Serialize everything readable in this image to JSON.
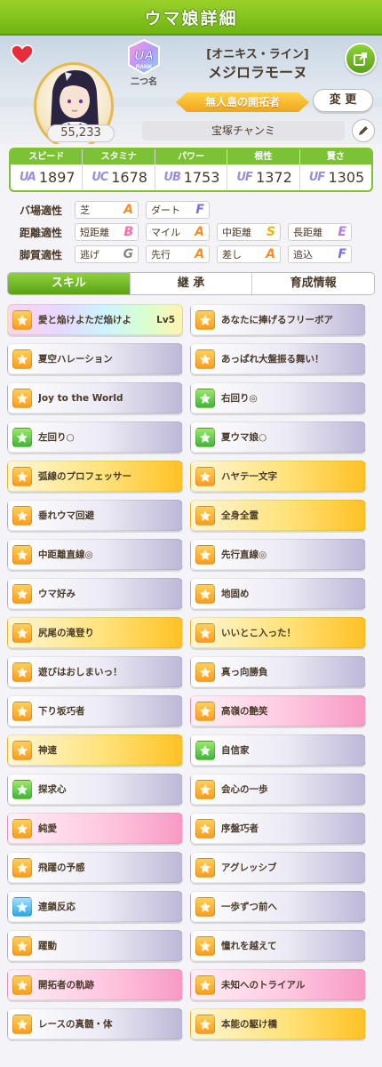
{
  "header": {
    "title": "ウマ娘詳細"
  },
  "profile": {
    "fans": "55,233",
    "rank_label": "UA",
    "rank_word": "RANK",
    "rank_sub": "二つ名",
    "epithet": "[オニキス・ライン]",
    "name": "メジロラモーヌ",
    "title_ribbon": "無人島の開拓者",
    "change_label": "変 更",
    "trainer": "宝塚チャンミ"
  },
  "stats": [
    {
      "label": "スピード",
      "grade": "UA",
      "value": "1897"
    },
    {
      "label": "スタミナ",
      "grade": "UC",
      "value": "1678"
    },
    {
      "label": "パワー",
      "grade": "UB",
      "value": "1753"
    },
    {
      "label": "根性",
      "grade": "UF",
      "value": "1372"
    },
    {
      "label": "賢さ",
      "grade": "UF",
      "value": "1305"
    }
  ],
  "aptitudes": [
    {
      "label": "バ場適性",
      "cells": [
        {
          "name": "芝",
          "grade": "A"
        },
        {
          "name": "ダート",
          "grade": "F"
        }
      ]
    },
    {
      "label": "距離適性",
      "cells": [
        {
          "name": "短距離",
          "grade": "B"
        },
        {
          "name": "マイル",
          "grade": "A"
        },
        {
          "name": "中距離",
          "grade": "S"
        },
        {
          "name": "長距離",
          "grade": "E"
        }
      ]
    },
    {
      "label": "脚質適性",
      "cells": [
        {
          "name": "逃げ",
          "grade": "G"
        },
        {
          "name": "先行",
          "grade": "A"
        },
        {
          "name": "差し",
          "grade": "A"
        },
        {
          "name": "追込",
          "grade": "F"
        }
      ]
    }
  ],
  "grade_colors": {
    "S": "#f0b300",
    "A": "#ff8a1e",
    "B": "#ff6aa8",
    "C": "#7bc83a",
    "D": "#3fb2e0",
    "E": "#b87ae0",
    "F": "#7a6ee6",
    "G": "#8a8a8a"
  },
  "tabs": [
    "スキル",
    "継 承",
    "育成情報"
  ],
  "skills": [
    {
      "name": "愛と焔けよただ焔けよ",
      "lv": "Lv5",
      "style": "rainbow",
      "icon": "orange"
    },
    {
      "name": "あなたに捧げるフリーボア",
      "style": "normal",
      "icon": "orange"
    },
    {
      "name": "夏空ハレーション",
      "style": "normal",
      "icon": "orange"
    },
    {
      "name": "あっぱれ大盤振る舞い！",
      "style": "normal",
      "icon": "orange"
    },
    {
      "name": "Joy to the World",
      "style": "normal",
      "icon": "orange"
    },
    {
      "name": "右回り◎",
      "style": "normal",
      "icon": "green"
    },
    {
      "name": "左回り○",
      "style": "normal",
      "icon": "green"
    },
    {
      "name": "夏ウマ娘○",
      "style": "normal",
      "icon": "green"
    },
    {
      "name": "弧線のプロフェッサー",
      "style": "gold",
      "icon": "orange"
    },
    {
      "name": "ハヤテ一文字",
      "style": "gold",
      "icon": "orange"
    },
    {
      "name": "垂れウマ回避",
      "style": "normal",
      "icon": "orange"
    },
    {
      "name": "全身全霊",
      "style": "gold",
      "icon": "orange"
    },
    {
      "name": "中距離直線◎",
      "style": "normal",
      "icon": "orange"
    },
    {
      "name": "先行直線◎",
      "style": "normal",
      "icon": "orange"
    },
    {
      "name": "ウマ好み",
      "style": "normal",
      "icon": "orange"
    },
    {
      "name": "地固め",
      "style": "normal",
      "icon": "orange"
    },
    {
      "name": "尻尾の滝登り",
      "style": "gold",
      "icon": "orange"
    },
    {
      "name": "いいとこ入った！",
      "style": "gold",
      "icon": "orange"
    },
    {
      "name": "遊びはおしまいっ！",
      "style": "normal",
      "icon": "orange"
    },
    {
      "name": "真っ向勝負",
      "style": "normal",
      "icon": "orange"
    },
    {
      "name": "下り坂巧者",
      "style": "normal",
      "icon": "orange"
    },
    {
      "name": "高嶺の艶笑",
      "style": "pink",
      "icon": "orange"
    },
    {
      "name": "神速",
      "style": "gold",
      "icon": "orange"
    },
    {
      "name": "自信家",
      "style": "normal",
      "icon": "green"
    },
    {
      "name": "探求心",
      "style": "normal",
      "icon": "green"
    },
    {
      "name": "会心の一歩",
      "style": "normal",
      "icon": "orange"
    },
    {
      "name": "純愛",
      "style": "pink",
      "icon": "orange"
    },
    {
      "name": "序盤巧者",
      "style": "normal",
      "icon": "orange"
    },
    {
      "name": "飛躍の予感",
      "style": "normal",
      "icon": "orange"
    },
    {
      "name": "アグレッシブ",
      "style": "normal",
      "icon": "orange"
    },
    {
      "name": "連鎖反応",
      "style": "normal",
      "icon": "blue"
    },
    {
      "name": "一歩ずつ前へ",
      "style": "normal",
      "icon": "orange"
    },
    {
      "name": "躍動",
      "style": "normal",
      "icon": "orange"
    },
    {
      "name": "憧れを越えて",
      "style": "normal",
      "icon": "orange"
    },
    {
      "name": "開拓者の軌跡",
      "style": "pink",
      "icon": "orange"
    },
    {
      "name": "未知へのトライアル",
      "style": "pink",
      "icon": "orange"
    },
    {
      "name": "レースの真髄・体",
      "style": "normal",
      "icon": "orange"
    },
    {
      "name": "本能の駆け橋",
      "style": "gold",
      "icon": "orange"
    }
  ]
}
